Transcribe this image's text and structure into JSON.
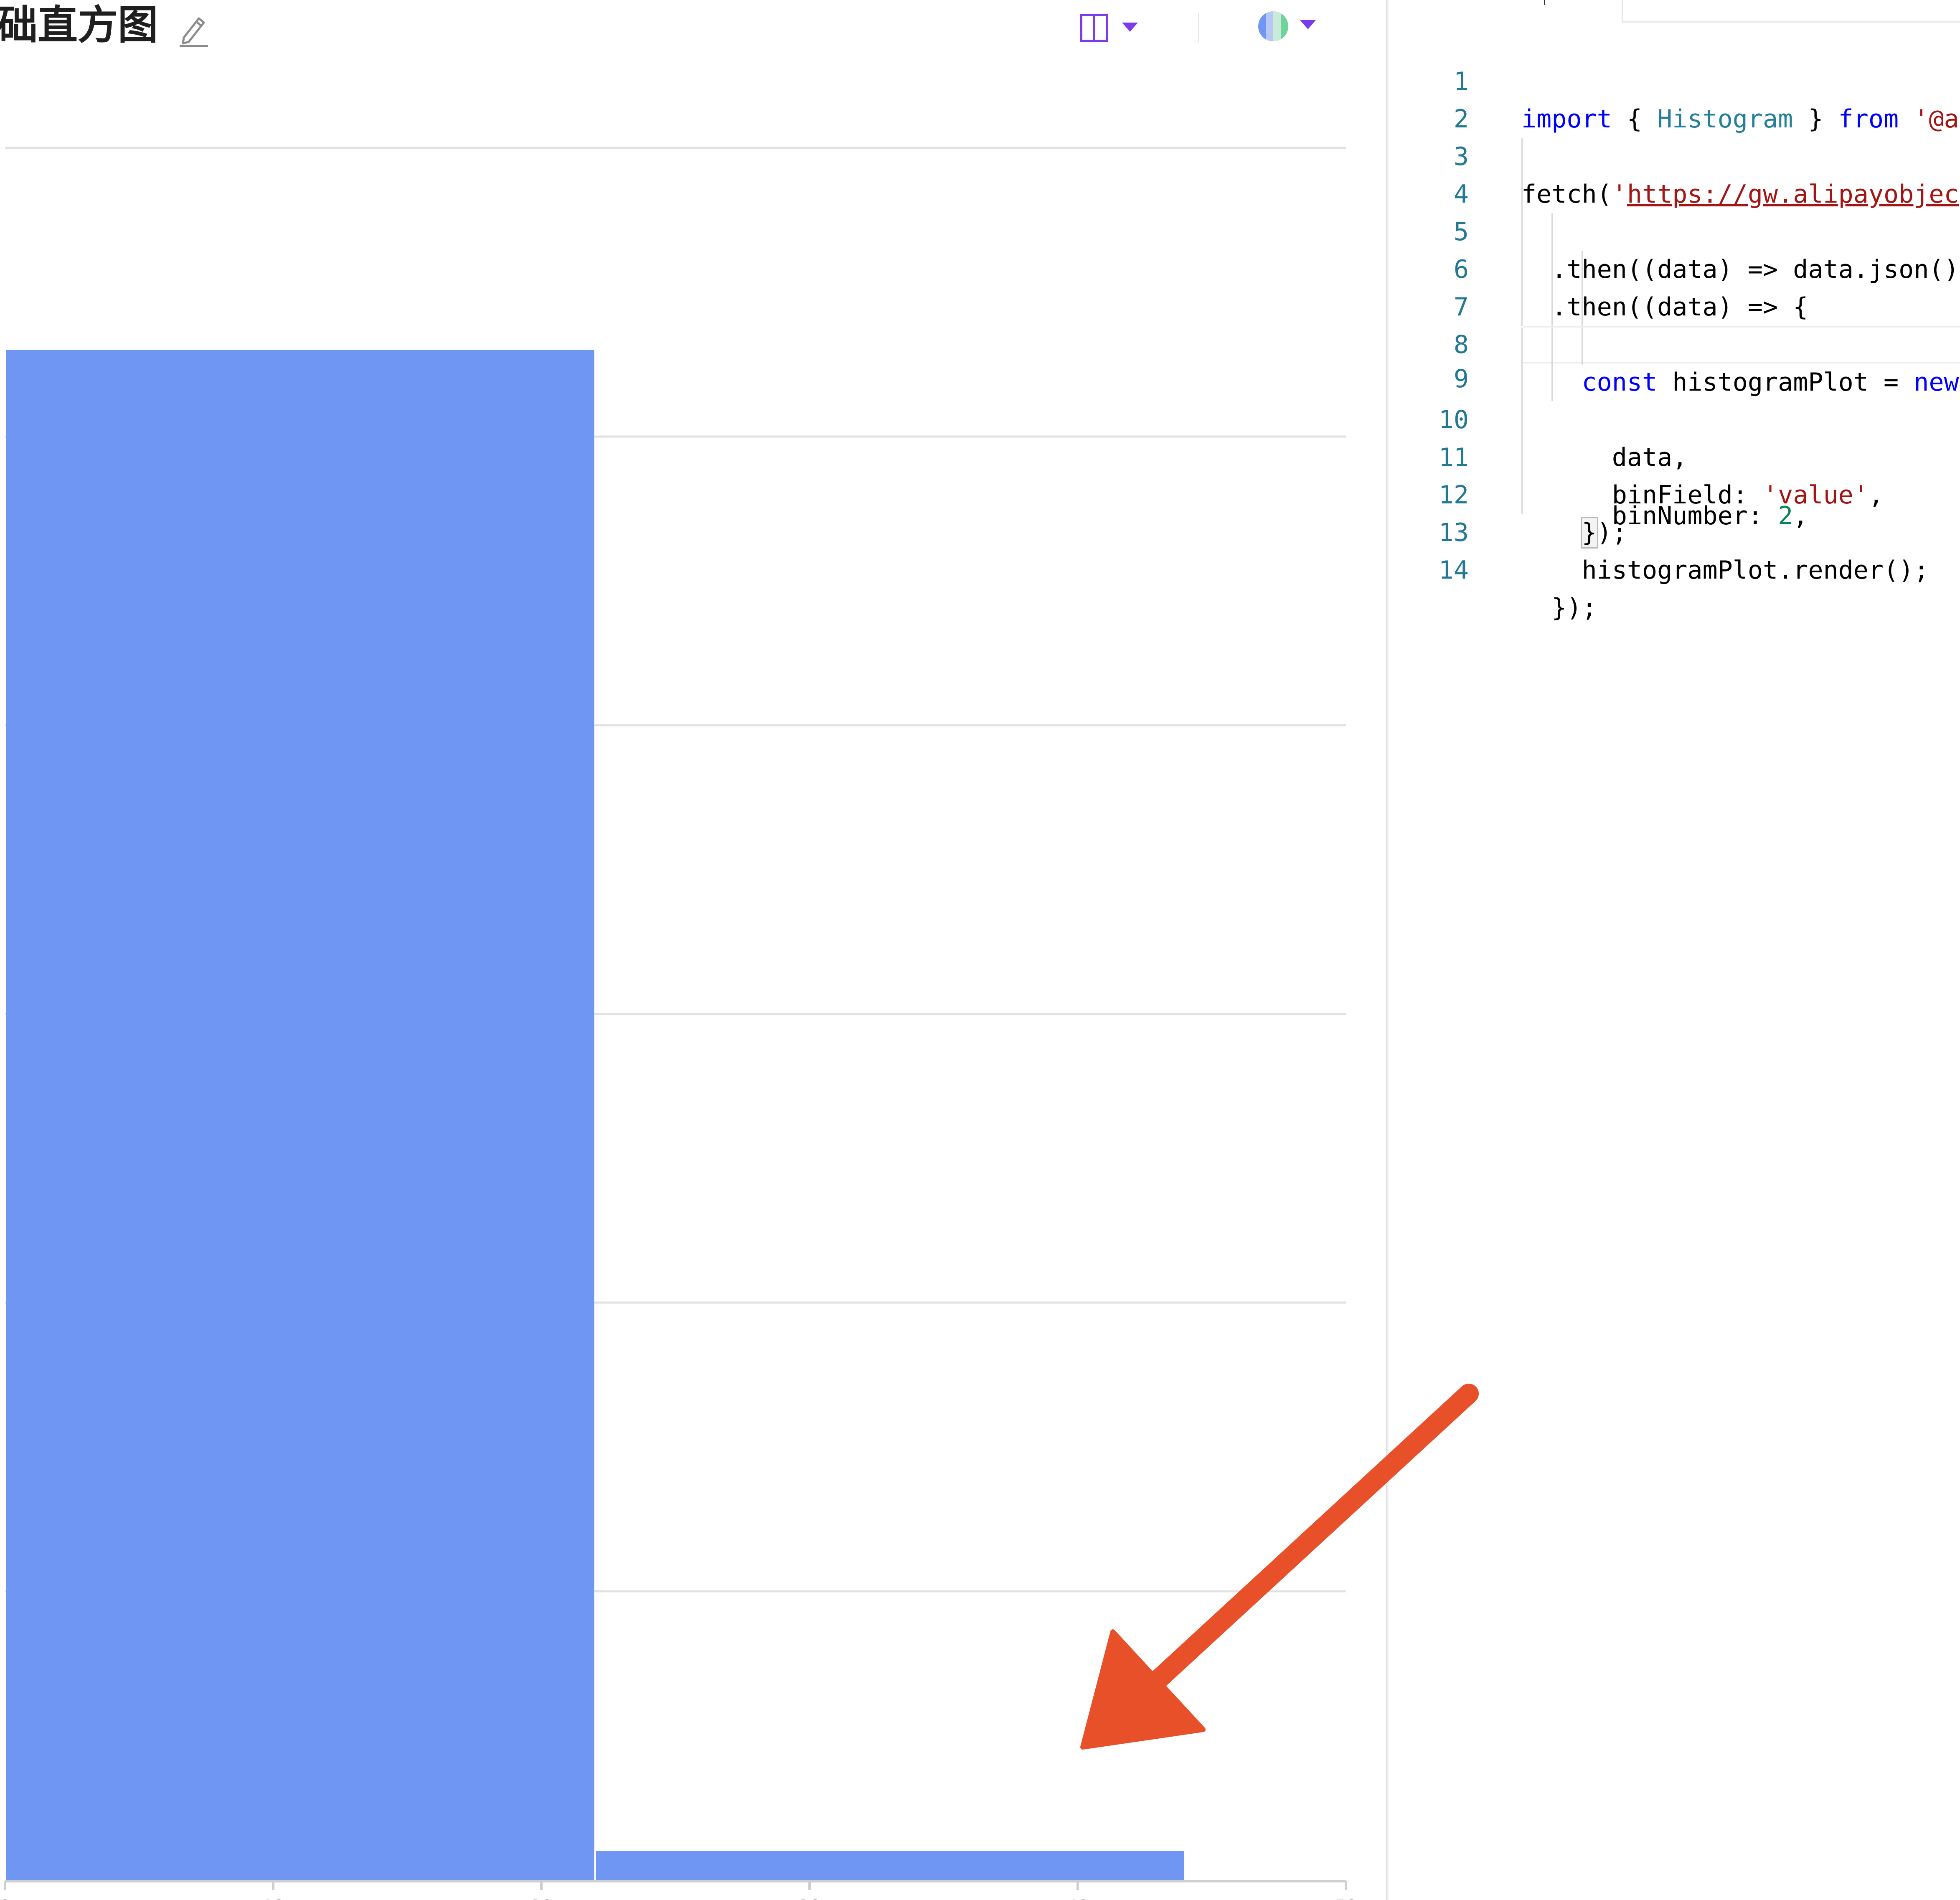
{
  "preview": {
    "title": "础直方图",
    "colors": {
      "bar": "#6f96f2",
      "grid": "#e2e2e2",
      "axis": "#cfcfcf",
      "icon_purple": "#7c3aed",
      "arrow": "#e8502a"
    },
    "icons": {
      "edit": "pencil-icon",
      "layout": "layout-columns-icon",
      "theme": "theme-palette-icon",
      "dropdown": "caret-down-icon"
    }
  },
  "chart_data": {
    "type": "bar",
    "chart_kind": "histogram",
    "bins": [
      {
        "x0": 0,
        "x1": 22,
        "count": 53
      },
      {
        "x0": 22,
        "x1": 44,
        "count": 1
      }
    ],
    "xlim": [
      0,
      50
    ],
    "ylim": [
      0,
      60
    ],
    "x_ticks": [
      "0",
      "10",
      "20",
      "30",
      "40",
      "50"
    ],
    "grid": "horizontal",
    "legend": "none"
  },
  "editor": {
    "lines": [
      {
        "n": "1",
        "text": "import { Histogram } from '@a"
      },
      {
        "n": "2",
        "text": ""
      },
      {
        "n": "3",
        "text": "fetch('https://gw.alipayobjec"
      },
      {
        "n": "4",
        "text": "  .then((data) => data.json()"
      },
      {
        "n": "5",
        "text": "  .then((data) => {"
      },
      {
        "n": "6",
        "text": "    const histogramPlot = new"
      },
      {
        "n": "7",
        "text": "      data,"
      },
      {
        "n": "8",
        "text": "      binField: 'value',"
      },
      {
        "n": "9",
        "text": "      binNumber: 2,"
      },
      {
        "n": "10",
        "text": "    });"
      },
      {
        "n": "11",
        "text": ""
      },
      {
        "n": "12",
        "text": "    histogramPlot.render();"
      },
      {
        "n": "13",
        "text": "  });"
      },
      {
        "n": "14",
        "text": ""
      }
    ],
    "active_line": "9"
  }
}
